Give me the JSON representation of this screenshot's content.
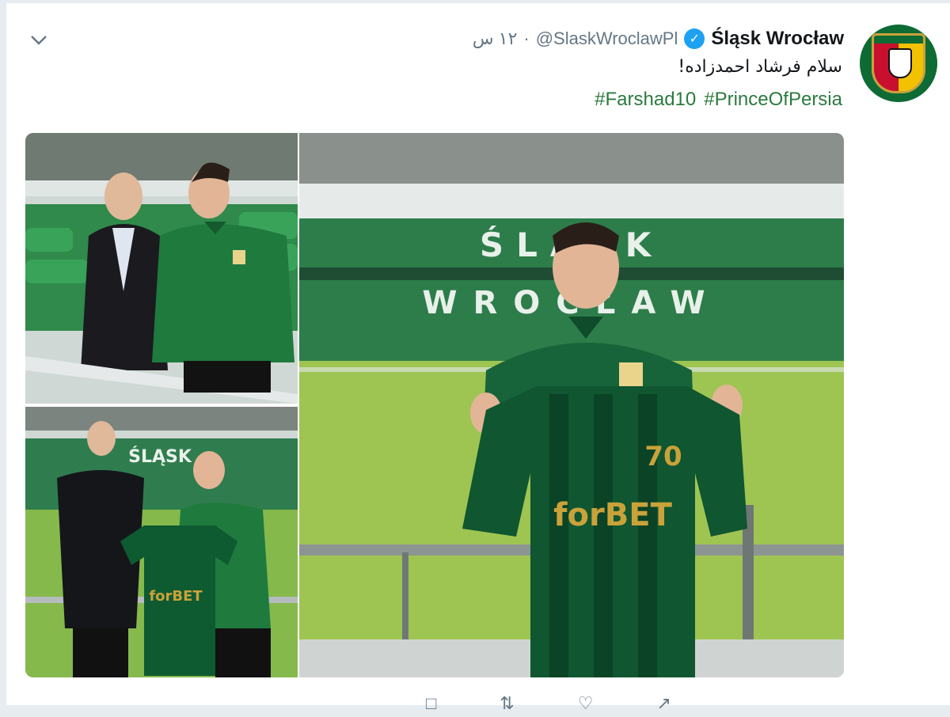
{
  "tweet": {
    "display_name": "Śląsk Wrocław",
    "handle": "@SlaskWroclawPl",
    "separator": "·",
    "time": "۱۲ س",
    "text": "سلام فرشاد احمدزاده!",
    "hashtags": [
      "#Farshad10",
      "#PrinceOfPersia"
    ]
  },
  "icons": {
    "verified": "verified-badge-icon",
    "chevron": "chevron-down-icon",
    "actions": [
      "reply-icon",
      "retweet-icon",
      "like-icon",
      "share-icon"
    ]
  },
  "images": [
    {
      "name": "signing-photo-seated",
      "description": "two men seated in green stadium seats"
    },
    {
      "name": "signing-photo-handshake",
      "description": "handshake holding green jersey"
    },
    {
      "name": "signing-photo-jersey",
      "description": "player holding green Śląsk jersey in stadium"
    }
  ],
  "stadium_sign": {
    "top": "ŚLĄSK",
    "bottom": "WROCŁAW"
  },
  "jersey_text": {
    "sponsor": "forBET",
    "number": "70"
  },
  "colors": {
    "brand_green": "#0e6b34",
    "hashtag_green": "#2b7a3e",
    "verified_blue": "#1da1f2",
    "muted_gray": "#657786",
    "text_black": "#14171a"
  }
}
